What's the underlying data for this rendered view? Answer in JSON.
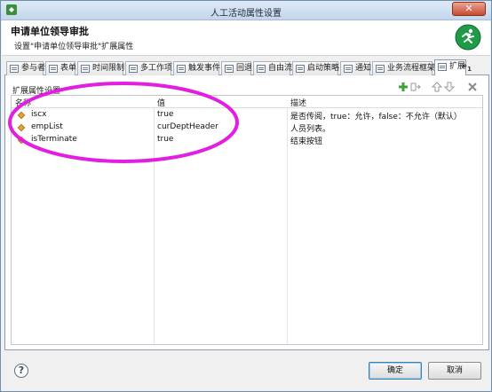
{
  "window": {
    "title": "人工活动属性设置",
    "close_label": "✕"
  },
  "header": {
    "title": "申请单位领导审批",
    "subtitle": "设置\"申请单位领导审批\"扩展属性",
    "icon": "running-man-icon"
  },
  "tabs": [
    {
      "label": "参与者",
      "active": false
    },
    {
      "label": "表单",
      "active": false
    },
    {
      "label": "时间限制",
      "active": false
    },
    {
      "label": "多工作项",
      "active": false
    },
    {
      "label": "触发事件",
      "active": false
    },
    {
      "label": "回退",
      "active": false
    },
    {
      "label": "自由流",
      "active": false
    },
    {
      "label": "启动策略",
      "active": false
    },
    {
      "label": "通知",
      "active": false
    },
    {
      "label": "业务流程框架",
      "active": false
    },
    {
      "label": "扩展",
      "active": true
    }
  ],
  "tab_overflow": {
    "label": "»",
    "count": "1"
  },
  "panel": {
    "section_label": "扩展属性设置",
    "tools": [
      "add-icon",
      "import-icon",
      "move-up-icon",
      "move-down-icon",
      "delete-icon"
    ]
  },
  "table": {
    "columns": [
      "名称",
      "值",
      "描述"
    ],
    "rows": [
      {
        "name": "iscx",
        "value": "true",
        "description": "是否传阅，true：允许，false：不允许（默认）"
      },
      {
        "name": "empList",
        "value": "curDeptHeader",
        "description": "人员列表。"
      },
      {
        "name": "isTerminate",
        "value": "true",
        "description": "结束按钮"
      }
    ]
  },
  "footer": {
    "help_label": "?",
    "ok_label": "确定",
    "cancel_label": "取消"
  },
  "colors": {
    "annotation": "#e21ee0",
    "accent": "#3c7fb1"
  }
}
